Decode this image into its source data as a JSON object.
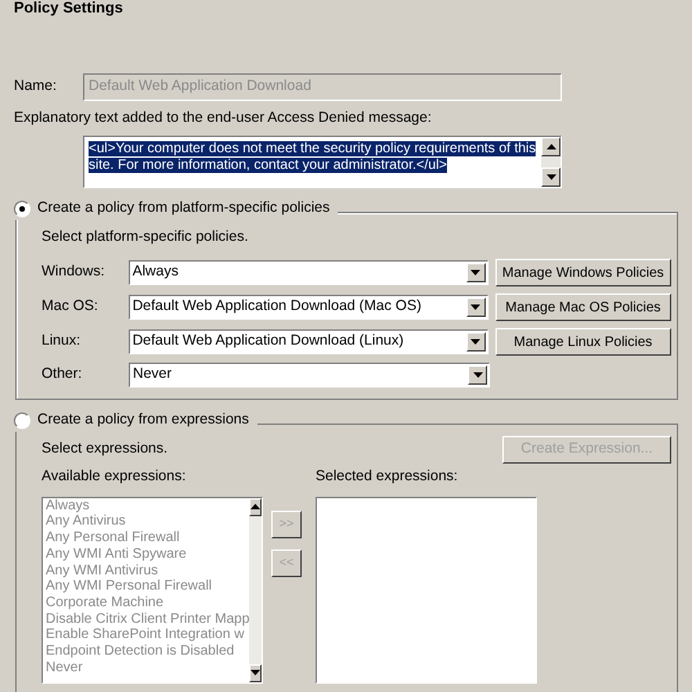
{
  "title": "Policy Settings",
  "name_field": {
    "label": "Name:",
    "value": "Default Web Application Download",
    "disabled": true
  },
  "explanatory": {
    "label": "Explanatory text added to the end-user Access Denied message:",
    "value": "<ul>Your computer does not meet the security policy requirements of this site. For more information, contact your administrator.</ul>",
    "selected": true
  },
  "platform_group": {
    "label": "Create a policy from platform-specific policies",
    "selected": true,
    "instruction": "Select platform-specific policies.",
    "rows": [
      {
        "label": "Windows:",
        "value": "Always",
        "button": "Manage Windows Policies"
      },
      {
        "label": "Mac OS:",
        "value": "Default Web Application Download (Mac OS)",
        "button": "Manage Mac OS Policies"
      },
      {
        "label": "Linux:",
        "value": "Default Web Application Download (Linux)",
        "button": "Manage Linux Policies"
      },
      {
        "label": "Other:",
        "value": "Never"
      }
    ]
  },
  "expression_group": {
    "label": "Create a policy from expressions",
    "selected": false,
    "instruction": "Select expressions.",
    "create_button": {
      "label": "Create Expression...",
      "disabled": true
    },
    "available": {
      "label": "Available expressions:",
      "disabled": true,
      "items": [
        "Always",
        "Any Antivirus",
        "Any Personal Firewall",
        "Any WMI Anti Spyware",
        "Any WMI Antivirus",
        "Any WMI Personal Firewall",
        "Corporate Machine",
        "Disable Citrix Client Printer Mapp",
        "Enable SharePoint Integration w",
        "Endpoint Detection is Disabled",
        "Never"
      ]
    },
    "add_button": ">>",
    "remove_button": "<<",
    "selected_list": {
      "label": "Selected expressions:"
    }
  }
}
